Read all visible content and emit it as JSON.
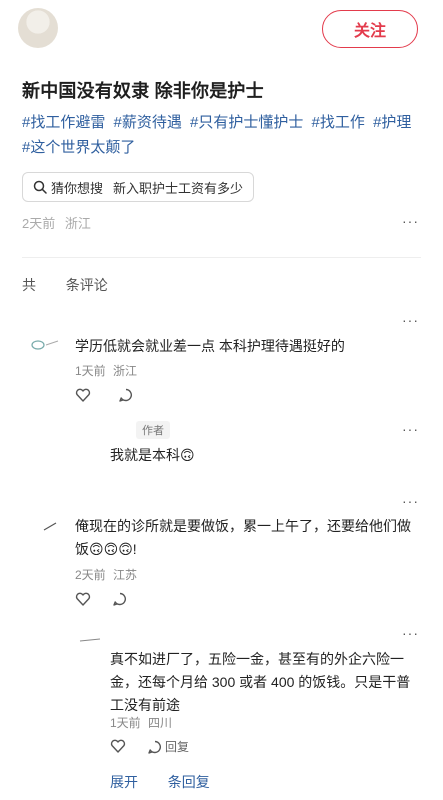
{
  "header": {
    "follow_label": "关注"
  },
  "post": {
    "title": "新中国没有奴隶 除非你是护士",
    "tags": [
      "#找工作避雷",
      "#薪资待遇",
      "#只有护士懂护士",
      "#找工作",
      "#护理",
      "#这个世界太颠了"
    ],
    "guess_prefix": "猜你想搜",
    "guess_query": "新入职护士工资有多少",
    "time": "2天前",
    "location": "浙江",
    "more": "···"
  },
  "comments_header": {
    "prefix": "共",
    "suffix": "条评论"
  },
  "comments": [
    {
      "text": "学历低就会就业差一点 本科护理待遇挺好的",
      "time": "1天前",
      "location": "浙江",
      "more": "···"
    },
    {
      "author_tag": "作者",
      "text": "我就是本科",
      "emoji": "🙃",
      "more": "···"
    },
    {
      "text_line1": "俺现在的诊所就是要做饭，累一上午了，还要给他们做",
      "text_line2_prefix": "饭",
      "emojis": "🙃🙃🙃",
      "text_line2_suffix": "!",
      "time": "2天前",
      "location": "江苏",
      "more": "···"
    },
    {
      "text": "真不如进厂了，五险一金，甚至有的外企六险一金，还每个月给 300 或者 400 的饭钱。只是干普工没有前途",
      "time": "1天前",
      "location": "四川",
      "reply_label": "回复",
      "more": "···"
    }
  ],
  "expand": {
    "prefix": "展开",
    "suffix": "条回复"
  },
  "colors": {
    "accent": "#e33b4c",
    "link": "#2f5f9f",
    "meta": "#aaaaaa"
  }
}
